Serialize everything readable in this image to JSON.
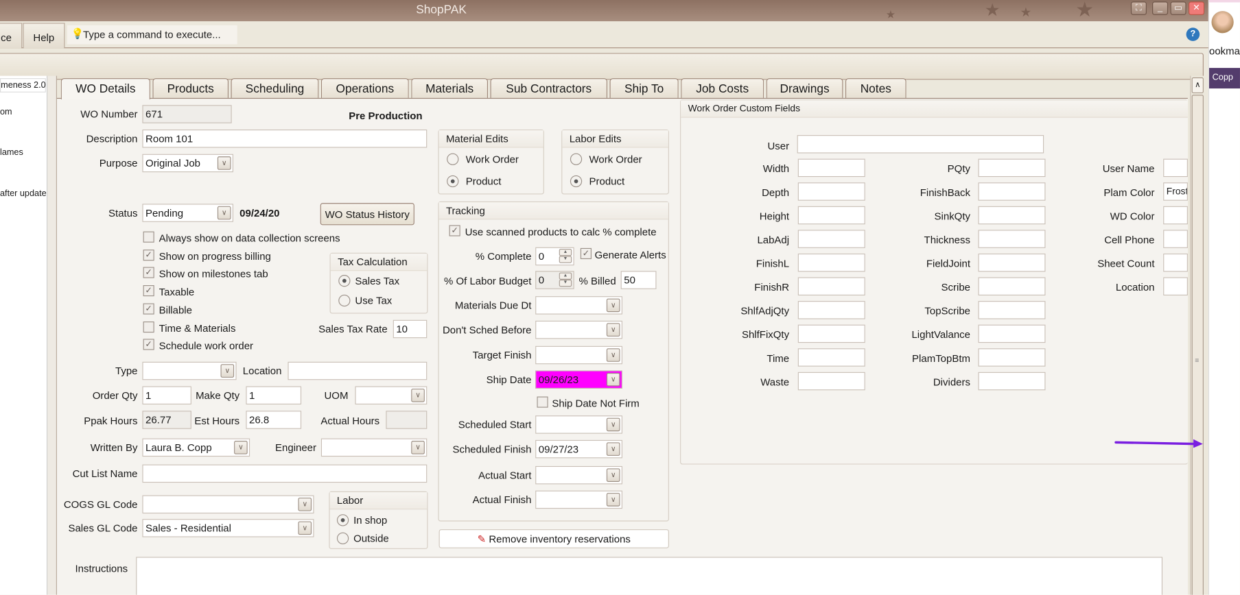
{
  "window": {
    "title": "ShopPAK"
  },
  "menu": {
    "tabs": [
      "ce",
      "Help"
    ],
    "command_placeholder": "Type a command to execute..."
  },
  "browser": {
    "bookmarks_text": "ookma",
    "user_chip": "Copp"
  },
  "sidebar": {
    "items": [
      "meness 2.0",
      "om",
      "lames",
      "after update"
    ]
  },
  "tabs": [
    "WO Details",
    "Products",
    "Scheduling",
    "Operations",
    "Materials",
    "Sub Contractors",
    "Ship To",
    "Job Costs",
    "Drawings",
    "Notes"
  ],
  "wo": {
    "wo_number_label": "WO Number",
    "wo_number": "671",
    "stage": "Pre Production",
    "description_label": "Description",
    "description": "Room 101",
    "purpose_label": "Purpose",
    "purpose": "Original Job",
    "status_label": "Status",
    "status": "Pending",
    "status_date": "09/24/20",
    "status_history_button": "WO Status History",
    "checkboxes": [
      {
        "label": "Always show on data collection screens",
        "checked": false
      },
      {
        "label": "Show on progress billing",
        "checked": true
      },
      {
        "label": "Show on milestones tab",
        "checked": true
      },
      {
        "label": "Taxable",
        "checked": true
      },
      {
        "label": "Billable",
        "checked": true
      },
      {
        "label": "Time & Materials",
        "checked": false
      },
      {
        "label": "Schedule work order",
        "checked": true
      }
    ],
    "tax": {
      "title": "Tax Calculation",
      "options": [
        "Sales Tax",
        "Use Tax"
      ],
      "selected": "Sales Tax",
      "rate_label": "Sales Tax Rate",
      "rate": "10"
    },
    "type_label": "Type",
    "type": "",
    "location_label": "Location",
    "location": "",
    "order_qty_label": "Order Qty",
    "order_qty": "1",
    "make_qty_label": "Make Qty",
    "make_qty": "1",
    "uom_label": "UOM",
    "uom": "",
    "ppak_hours_label": "Ppak Hours",
    "ppak_hours": "26.77",
    "est_hours_label": "Est Hours",
    "est_hours": "26.8",
    "actual_hours_label": "Actual Hours",
    "actual_hours": "",
    "written_by_label": "Written By",
    "written_by": "Laura B. Copp",
    "engineer_label": "Engineer",
    "engineer": "",
    "cut_list_label": "Cut List Name",
    "cut_list": "",
    "cogs_label": "COGS GL Code",
    "cogs": "",
    "sales_gl_label": "Sales GL Code",
    "sales_gl": "Sales - Residential",
    "labor": {
      "title": "Labor",
      "options": [
        "In shop",
        "Outside"
      ],
      "selected": "In shop"
    },
    "instructions_label": "Instructions",
    "instructions": ""
  },
  "material_edits": {
    "title": "Material Edits",
    "options": [
      "Work Order",
      "Product"
    ],
    "selected": "Product"
  },
  "labor_edits": {
    "title": "Labor Edits",
    "options": [
      "Work Order",
      "Product"
    ],
    "selected": "Product"
  },
  "tracking": {
    "title": "Tracking",
    "use_scanned_label": "Use scanned products to calc % complete",
    "use_scanned": true,
    "pct_complete_label": "% Complete",
    "pct_complete": "0",
    "generate_alerts_label": "Generate Alerts",
    "generate_alerts": true,
    "pct_labor_label": "% Of Labor Budget",
    "pct_labor": "0",
    "pct_billed_label": "% Billed",
    "pct_billed": "50",
    "dates": [
      {
        "label": "Materials Due Dt",
        "value": ""
      },
      {
        "label": "Don't Sched Before",
        "value": ""
      },
      {
        "label": "Target Finish",
        "value": ""
      },
      {
        "label": "Ship Date",
        "value": "09/26/23",
        "highlight": "#ff00ff"
      }
    ],
    "ship_not_firm_label": "Ship Date Not Firm",
    "ship_not_firm": false,
    "dates2": [
      {
        "label": "Scheduled Start",
        "value": ""
      },
      {
        "label": "Scheduled Finish",
        "value": "09/27/23"
      },
      {
        "label": "Actual Start",
        "value": ""
      },
      {
        "label": "Actual Finish",
        "value": ""
      }
    ]
  },
  "remove_reservations_button": "Remove inventory reservations",
  "custom": {
    "title": "Work Order Custom Fields",
    "user_label": "User",
    "user": "",
    "col1": [
      {
        "label": "Width",
        "value": ""
      },
      {
        "label": "Depth",
        "value": ""
      },
      {
        "label": "Height",
        "value": ""
      },
      {
        "label": "LabAdj",
        "value": ""
      },
      {
        "label": "FinishL",
        "value": ""
      },
      {
        "label": "FinishR",
        "value": ""
      },
      {
        "label": "ShlfAdjQty",
        "value": ""
      },
      {
        "label": "ShlfFixQty",
        "value": ""
      },
      {
        "label": "Time",
        "value": ""
      },
      {
        "label": "Waste",
        "value": ""
      }
    ],
    "col2": [
      {
        "label": "PQty",
        "value": ""
      },
      {
        "label": "FinishBack",
        "value": ""
      },
      {
        "label": "SinkQty",
        "value": ""
      },
      {
        "label": "Thickness",
        "value": ""
      },
      {
        "label": "FieldJoint",
        "value": ""
      },
      {
        "label": "Scribe",
        "value": ""
      },
      {
        "label": "TopScribe",
        "value": ""
      },
      {
        "label": "LightValance",
        "value": ""
      },
      {
        "label": "PlamTopBtm",
        "value": ""
      },
      {
        "label": "Dividers",
        "value": ""
      }
    ],
    "col3": [
      {
        "label": "User Name",
        "value": ""
      },
      {
        "label": "Plam Color",
        "value": "Frost"
      },
      {
        "label": "WD Color",
        "value": ""
      },
      {
        "label": "Cell Phone",
        "value": ""
      },
      {
        "label": "Sheet Count",
        "value": ""
      },
      {
        "label": "Location",
        "value": ""
      }
    ]
  },
  "colors": {
    "annotation_arrow": "#7a1fe0",
    "ship_date_highlight": "#ff00ff"
  }
}
